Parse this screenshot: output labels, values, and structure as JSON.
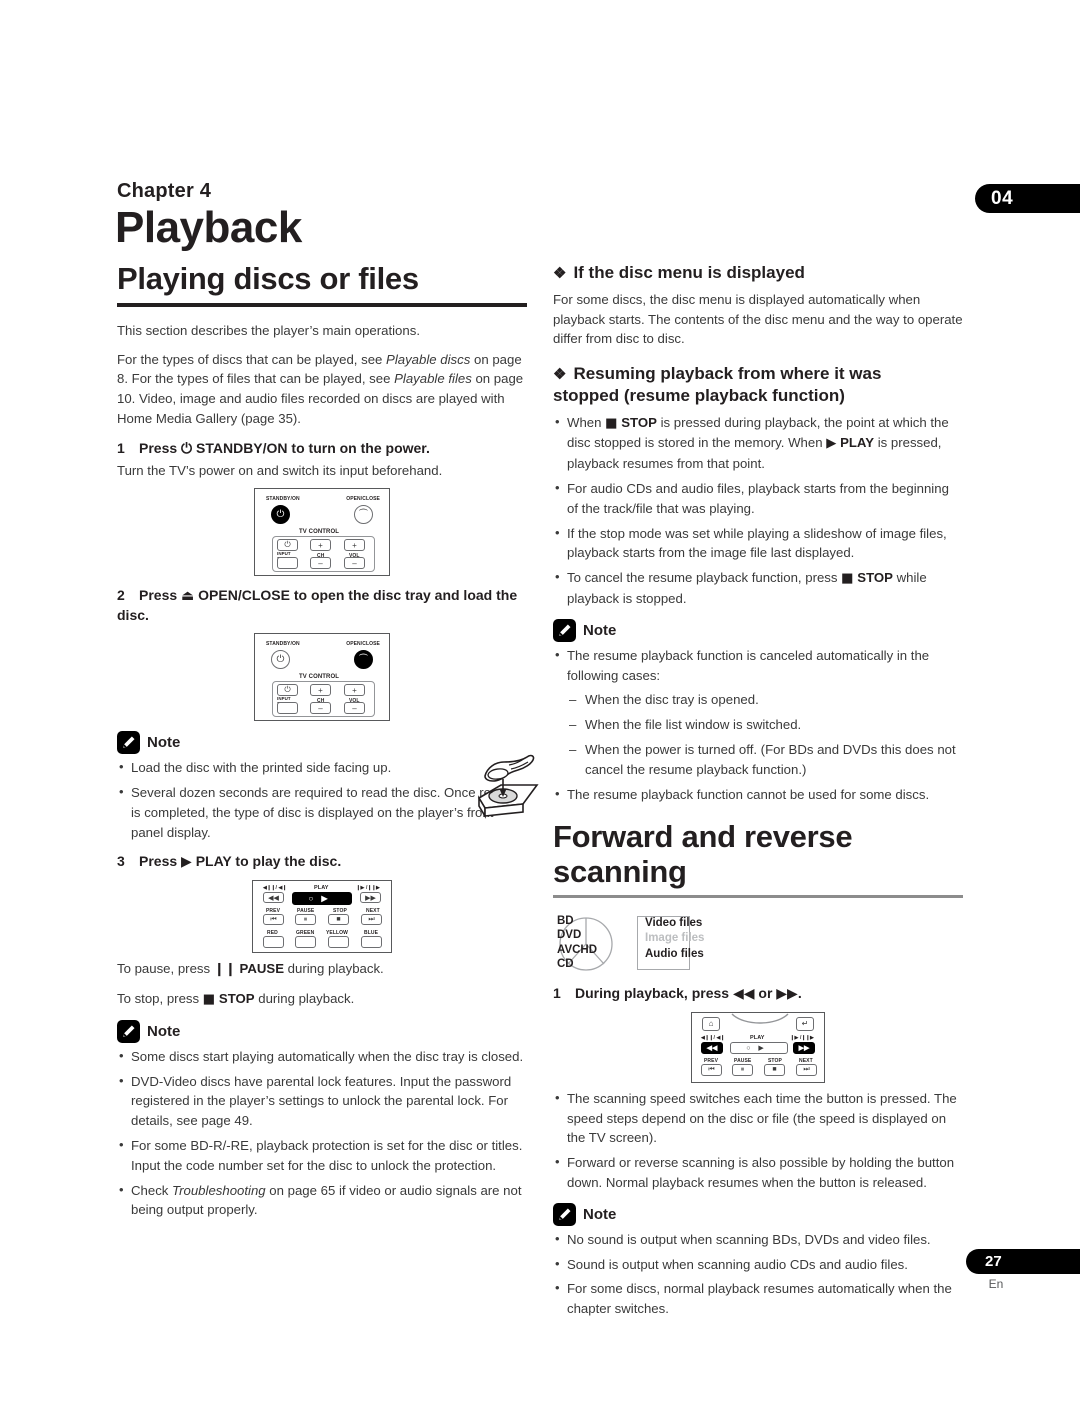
{
  "header": {
    "chapter_label": "Chapter 4",
    "chapter_title": "Playback",
    "chapter_badge": "04"
  },
  "footer": {
    "page_number": "27",
    "language_code": "En"
  },
  "left_column": {
    "section_title": "Playing discs or files",
    "intro_1": "This section describes the player’s main operations.",
    "intro_2_a": "For the types of discs that can be played, see ",
    "intro_2_i1": "Playable discs",
    "intro_2_b": " on page 8. For the types of files that can be played, see ",
    "intro_2_i2": "Playable files",
    "intro_2_c": " on page 10. Video, image and audio files recorded on discs are played with Home Media Gallery (page 35).",
    "step1_num": "1",
    "step1_text_a": "Press ",
    "step1_glyph": "⏻",
    "step1_text_b": " STANDBY/ON to turn on the power.",
    "step1_body": "Turn the TV’s power on and switch its input beforehand.",
    "step2_num": "2",
    "step2_text_a": "Press ",
    "step2_glyph": "⏏",
    "step2_text_b": " OPEN/CLOSE to open the disc tray and load the disc.",
    "note1_label": "Note",
    "note1_items": [
      "Load the disc with the printed side facing up.",
      "Several dozen seconds are required to read the disc. Once reading is completed, the type of disc is displayed on the player’s front panel display."
    ],
    "step3_num": "3",
    "step3_text_a": "Press ",
    "step3_glyph": "▶",
    "step3_text_b": " PLAY to play the disc.",
    "pause_line_a": "To pause, press ",
    "pause_glyph": "❙❙",
    "pause_label": "PAUSE",
    "pause_line_b": " during playback.",
    "stop_line_a": "To stop, press ",
    "stop_glyph": "■",
    "stop_label": "STOP",
    "stop_line_b": " during playback.",
    "note2_label": "Note",
    "note2_items": [
      "Some discs start playing automatically when the disc tray is closed.",
      "DVD-Video discs have parental lock features. Input the password registered in the player’s settings to unlock the parental lock. For details, see page 49.",
      "For some BD-R/-RE, playback protection is set for the disc or titles. Input the code number set for the disc to unlock the protection."
    ],
    "note2_last_a": "Check ",
    "note2_last_i": "Troubleshooting",
    "note2_last_b": " on page 65 if video or audio signals are not being output properly."
  },
  "right_column": {
    "sub1_title": "If the disc menu is displayed",
    "sub1_body": "For some discs, the disc menu is displayed automatically when playback starts. The contents of the disc menu and the way to operate differ from disc to disc.",
    "sub2_title_line1": "Resuming playback from where it was",
    "sub2_title_line2": "stopped (resume playback function)",
    "resume_b1_a": "When ",
    "resume_b1_stop": "STOP",
    "resume_b1_b": " is pressed during playback, the point at which the disc stopped is stored in the memory. When ",
    "resume_b1_play": "PLAY",
    "resume_b1_c": " is pressed, playback resumes from that point.",
    "resume_b2": "For audio CDs and audio files, playback starts from the beginning of the track/file that was playing.",
    "resume_b3": "If the stop mode was set while playing a slideshow of image files, playback starts from the image file last displayed.",
    "resume_b4_a": "To cancel the resume playback function, press ",
    "resume_b4_stop": "STOP",
    "resume_b4_b": " while playback is stopped.",
    "note3_label": "Note",
    "note3_lead": "The resume playback function is canceled automatically in the following cases:",
    "note3_dashes": [
      "When the disc tray is opened.",
      "When the file list window is switched.",
      "When the power is turned off. (For BDs and DVDs this does not cancel the resume playback function.)"
    ],
    "note3_last": "The resume playback function cannot be used for some discs.",
    "section2_title": "Forward and reverse scanning",
    "media_discs": [
      "BD",
      "DVD",
      "AVCHD",
      "CD"
    ],
    "media_files": [
      "Video files",
      "Image files",
      "Audio files"
    ],
    "media_files_disabled": [
      "Image files"
    ],
    "step1_num": "1",
    "step1_text_a": "During playback, press ",
    "step1_glyph_rev": "◀◀",
    "step1_text_b": " or ",
    "step1_glyph_fwd": "▶▶",
    "step1_text_c": ".",
    "scan_bullets": [
      "The scanning speed switches each time the button is pressed. The speed steps depend on the disc or file (the speed is displayed on the TV screen).",
      "Forward or reverse scanning is also possible by holding the button down. Normal playback resumes when the button is released."
    ],
    "note4_label": "Note",
    "note4_items": [
      "No sound is output when scanning BDs, DVDs and video files.",
      "Sound is output when scanning audio CDs and audio files.",
      "For some discs, normal playback resumes automatically when the chapter switches."
    ]
  },
  "remote_panels": {
    "panel_standby": {
      "standby_label": "STANDBY/ON",
      "openclose_label": "OPEN/CLOSE",
      "tv_control_label": "TV CONTROL",
      "input_select_label": "INPUT SELECT",
      "ch_label": "CH",
      "vol_label": "VOL",
      "plus": "+",
      "minus": "–"
    },
    "panel_play": {
      "play_label": "PLAY",
      "prev_label": "PREV",
      "pause_label": "PAUSE",
      "stop_label": "STOP",
      "next_label": "NEXT",
      "red_label": "RED",
      "green_label": "GREEN",
      "yellow_label": "YELLOW",
      "blue_label": "BLUE",
      "rev_top_label": "◀❙❙/ ◀❙",
      "fwd_top_label": "❙▶ /❙❙▶"
    },
    "panel_scan": {
      "play_label": "PLAY",
      "prev_label": "PREV",
      "pause_label": "PAUSE",
      "stop_label": "STOP",
      "next_label": "NEXT",
      "rev_top_label": "◀❙❙/ ◀❙",
      "fwd_top_label": "❙▶ /❙❙▶"
    }
  },
  "colors": {
    "ink": "#231f20",
    "body_text": "#3a3a3a",
    "rule_grey": "#8c8c8c",
    "disabled": "#bcbec0"
  }
}
